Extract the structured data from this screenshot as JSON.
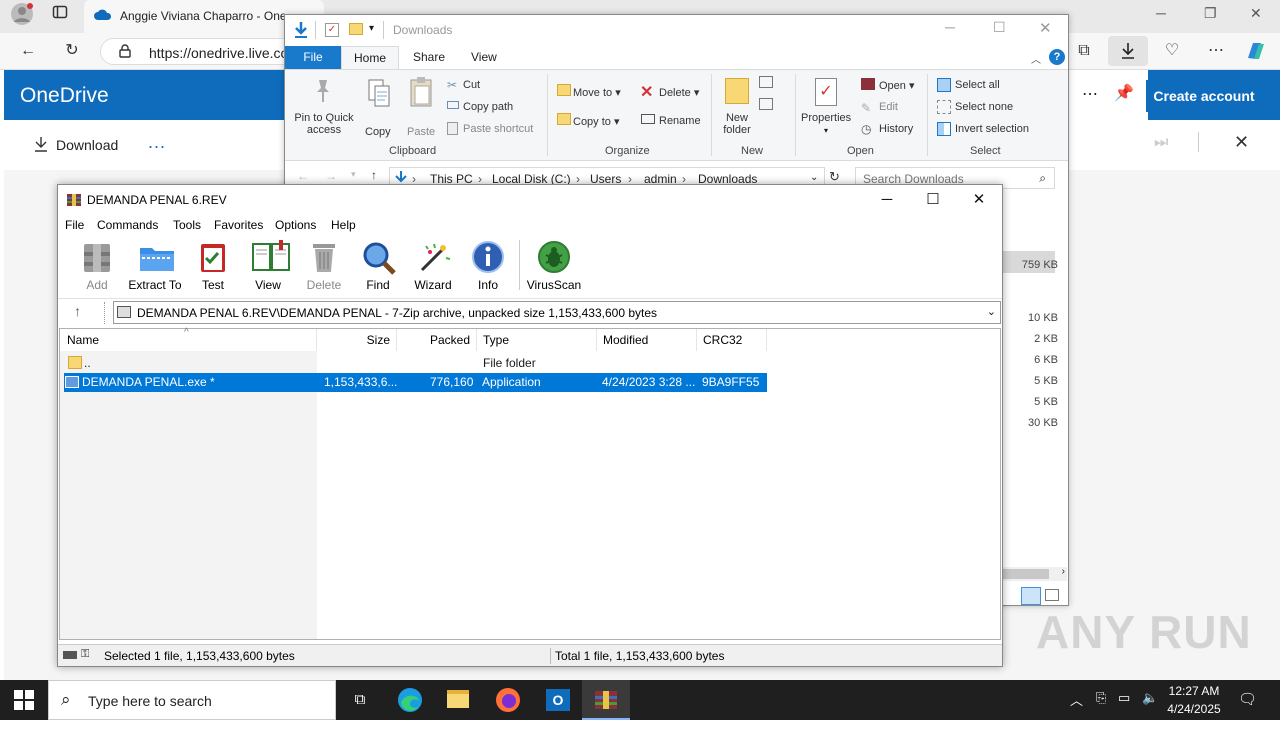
{
  "browser": {
    "tab_title": "Anggie Viviana Chaparro - One",
    "url": "https://onedrive.live.co",
    "create_account": "Create account"
  },
  "onedrive": {
    "brand": "OneDrive",
    "download_label": "Download",
    "more_label": "..."
  },
  "explorer": {
    "title": "Downloads",
    "tabs": [
      "File",
      "Home",
      "Share",
      "View"
    ],
    "clipboard": {
      "pin": "Pin to Quick access",
      "pin1": "Pin to Quick",
      "pin2": "access",
      "copy": "Copy",
      "paste": "Paste",
      "cut": "Cut",
      "copy_path": "Copy path",
      "paste_shortcut": "Paste shortcut",
      "group": "Clipboard"
    },
    "organize": {
      "move_to": "Move to",
      "copy_to": "Copy to",
      "delete": "Delete",
      "rename": "Rename",
      "group": "Organize"
    },
    "new": {
      "new_folder1": "New",
      "new_folder2": "folder",
      "group": "New"
    },
    "open": {
      "properties": "Properties",
      "open": "Open",
      "edit": "Edit",
      "history": "History",
      "group": "Open"
    },
    "select": {
      "select_all": "Select all",
      "select_none": "Select none",
      "invert": "Invert selection",
      "group": "Select"
    },
    "path": [
      "This PC",
      "Local Disk (C:)",
      "Users",
      "admin",
      "Downloads"
    ],
    "search_placeholder": "Search Downloads",
    "sizes": [
      "759 KB",
      "10 KB",
      "2 KB",
      "6 KB",
      "5 KB",
      "5 KB",
      "30 KB"
    ]
  },
  "winrar": {
    "title": "DEMANDA PENAL 6.REV",
    "menu": [
      "File",
      "Commands",
      "Tools",
      "Favorites",
      "Options",
      "Help"
    ],
    "toolbar": [
      "Add",
      "Extract To",
      "Test",
      "View",
      "Delete",
      "Find",
      "Wizard",
      "Info",
      "VirusScan"
    ],
    "path": "DEMANDA PENAL 6.REV\\DEMANDA PENAL - 7-Zip archive, unpacked size 1,153,433,600 bytes",
    "columns": [
      "Name",
      "Size",
      "Packed",
      "Type",
      "Modified",
      "CRC32"
    ],
    "rows": [
      {
        "name": "..",
        "size": "",
        "packed": "",
        "type": "File folder",
        "modified": "",
        "crc": ""
      },
      {
        "name": "DEMANDA PENAL.exe *",
        "size": "1,153,433,6...",
        "packed": "776,160",
        "type": "Application",
        "modified": "4/24/2023 3:28 ...",
        "crc": "9BA9FF55"
      }
    ],
    "status_left": "Selected 1 file, 1,153,433,600 bytes",
    "status_right": "Total 1 file, 1,153,433,600 bytes"
  },
  "taskbar": {
    "search_placeholder": "Type here to search",
    "time": "12:27 AM",
    "date": "4/24/2025"
  },
  "watermark": "ANY RUN"
}
